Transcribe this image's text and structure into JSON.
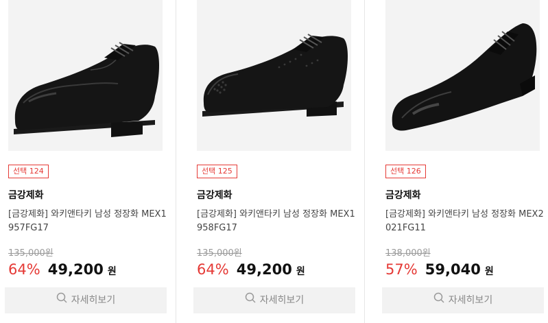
{
  "products": [
    {
      "badge": "선택 124",
      "brand": "금강제화",
      "name": "[금강제화] 와키앤타키 남성 정장화 MEX1957FG17",
      "original_price": "135,000원",
      "discount": "64%",
      "price": "49,200",
      "currency": "원",
      "view_label": "자세히보기",
      "image": "black-derby-cap-toe-shoe"
    },
    {
      "badge": "선택 125",
      "brand": "금강제화",
      "name": "[금강제화] 와키앤타키 남성 정장화 MEX1958FG17",
      "original_price": "135,000원",
      "discount": "64%",
      "price": "49,200",
      "currency": "원",
      "view_label": "자세히보기",
      "image": "black-brogue-derby-shoe"
    },
    {
      "badge": "선택 126",
      "brand": "금강제화",
      "name": "[금강제화] 와키앤타키 남성 정장화 MEX2021FG11",
      "original_price": "138,000원",
      "discount": "57%",
      "price": "59,040",
      "currency": "원",
      "view_label": "자세히보기",
      "image": "black-oxford-cap-toe-shoe"
    }
  ],
  "colors": {
    "accent": "#e53935",
    "button_bg": "#f2f2f2",
    "image_bg": "#f3f3f3"
  }
}
